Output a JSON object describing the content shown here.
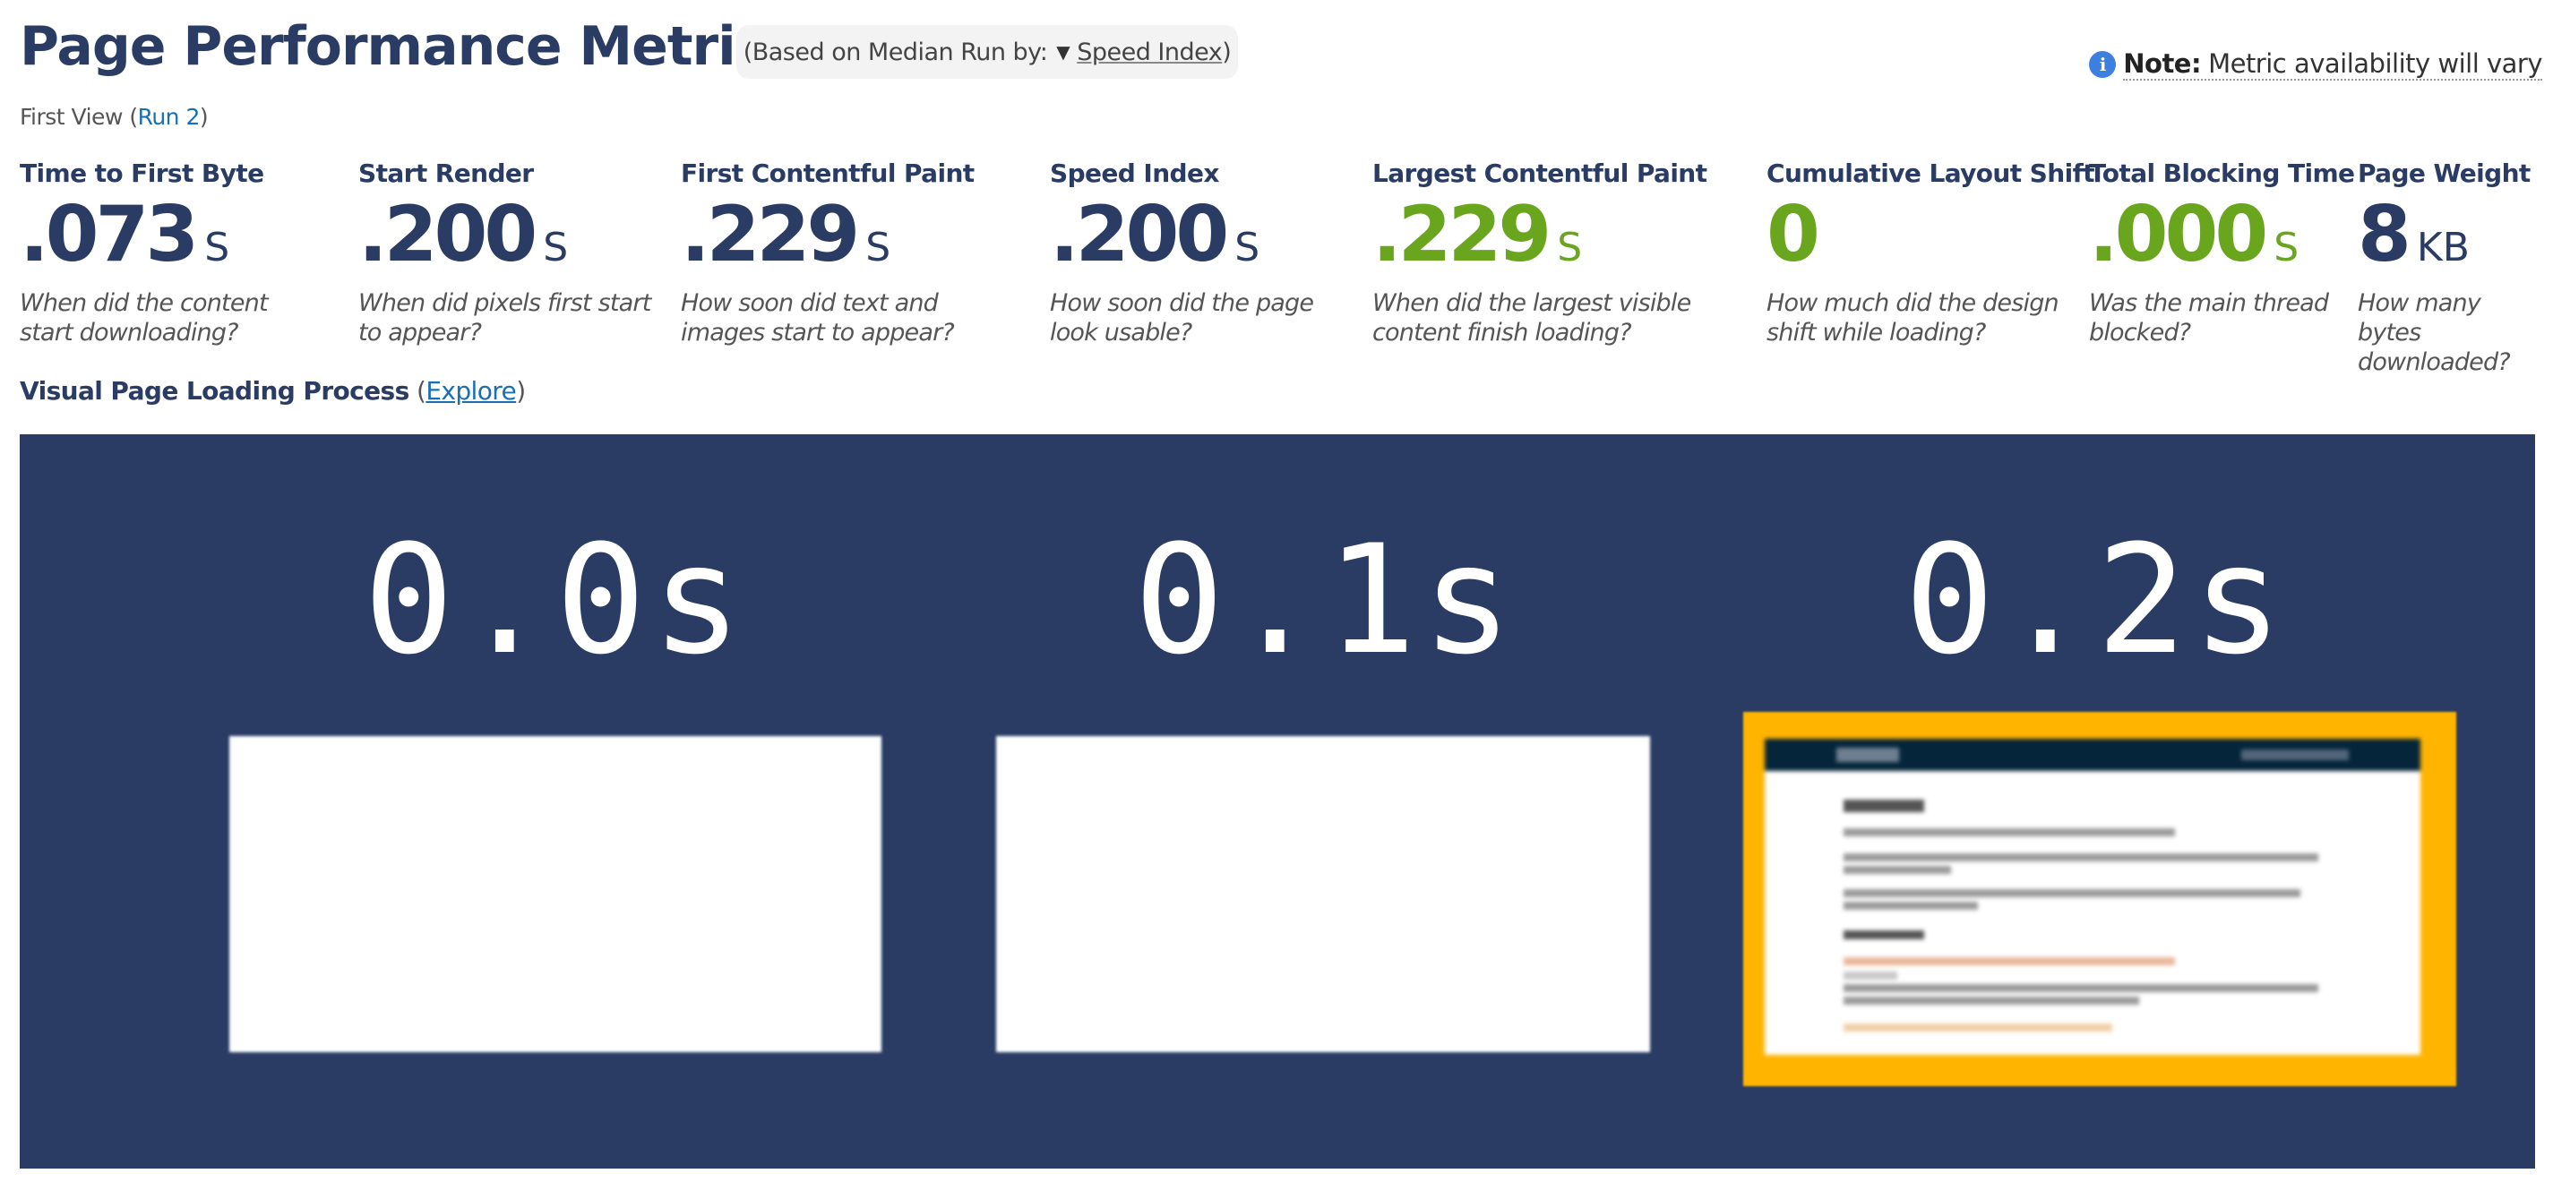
{
  "header": {
    "title": "Page Performance Metrics",
    "median_prefix": "(Based on Median Run by:",
    "median_selected": "Speed Index",
    "median_suffix": ")",
    "note_label": "Note:",
    "note_text": "Metric availability will vary",
    "info_icon": "info-icon"
  },
  "view": {
    "label": "First View (",
    "run_link": "Run 2",
    "close": ")"
  },
  "metrics": [
    {
      "label": "Time to First Byte",
      "value": ".073",
      "unit": "S",
      "desc": "When did the content start downloading?",
      "status": "neutral"
    },
    {
      "label": "Start Render",
      "value": ".200",
      "unit": "S",
      "desc": "When did pixels first start to appear?",
      "status": "neutral"
    },
    {
      "label": "First Contentful Paint",
      "value": ".229",
      "unit": "S",
      "desc": "How soon did text and images start to appear?",
      "status": "neutral"
    },
    {
      "label": "Speed Index",
      "value": ".200",
      "unit": "S",
      "desc": "How soon did the page look usable?",
      "status": "neutral"
    },
    {
      "label": "Largest Contentful Paint",
      "value": ".229",
      "unit": "S",
      "desc": "When did the largest visible content finish loading?",
      "status": "good"
    },
    {
      "label": "Cumulative Layout Shift",
      "value": "0",
      "unit": "",
      "desc": "How much did the design shift while loading?",
      "status": "good"
    },
    {
      "label": "Total Blocking Time",
      "value": ".000",
      "unit": "S",
      "desc": "Was the main thread blocked?",
      "status": "good"
    },
    {
      "label": "Page Weight",
      "value": "8",
      "unit": "KB",
      "desc": "How many bytes downloaded?",
      "status": "neutral"
    }
  ],
  "visual": {
    "title": "Visual Page Loading Process",
    "open_paren": " (",
    "explore_link": "Explore",
    "close_paren": ")",
    "frames": [
      {
        "time": "0.0s",
        "state": "blank",
        "highlighted": false
      },
      {
        "time": "0.1s",
        "state": "blank",
        "highlighted": false
      },
      {
        "time": "0.2s",
        "state": "rendered",
        "highlighted": true
      }
    ]
  },
  "colors": {
    "brand_navy": "#2a3c64",
    "good_green": "#6aa51e",
    "link_blue": "#1a6fb4",
    "highlight_orange": "#ffb400",
    "info_blue": "#3d7fde"
  }
}
